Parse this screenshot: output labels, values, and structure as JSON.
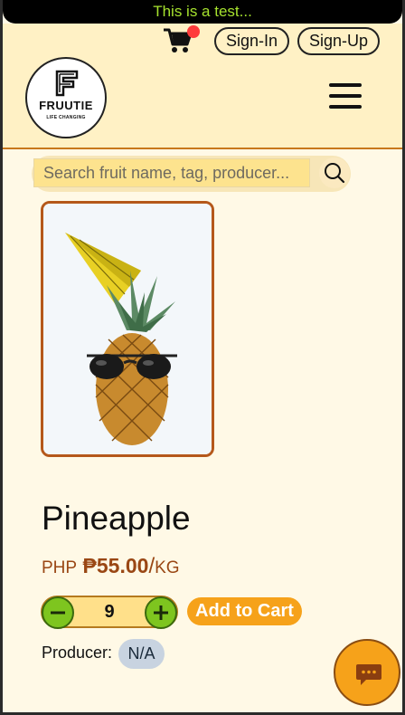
{
  "banner": {
    "text": "This is a test..."
  },
  "header": {
    "cart_icon": "shopping-cart-icon",
    "signin_label": "Sign-In",
    "signup_label": "Sign-Up",
    "logo": {
      "name": "FRUUTIE",
      "tagline": "LIFE CHANGING"
    },
    "menu_icon": "hamburger-menu-icon"
  },
  "search": {
    "placeholder": "Search fruit name, tag, producer...",
    "value": "",
    "icon": "search-icon"
  },
  "product": {
    "name": "Pineapple",
    "currency": "PHP",
    "price": "₱55.00",
    "unit_slash": "/",
    "unit": "KG",
    "quantity": "9",
    "add_to_cart_label": "Add to Cart",
    "producer_label": "Producer:",
    "producer_value": "N/A"
  },
  "chat": {
    "icon": "chat-bubble-icon"
  },
  "colors": {
    "accent": "#f6a21a",
    "header_bg": "#fff1c5",
    "page_bg": "#fff9e6",
    "price": "#9a4714",
    "qty_button": "#7ec51f"
  }
}
